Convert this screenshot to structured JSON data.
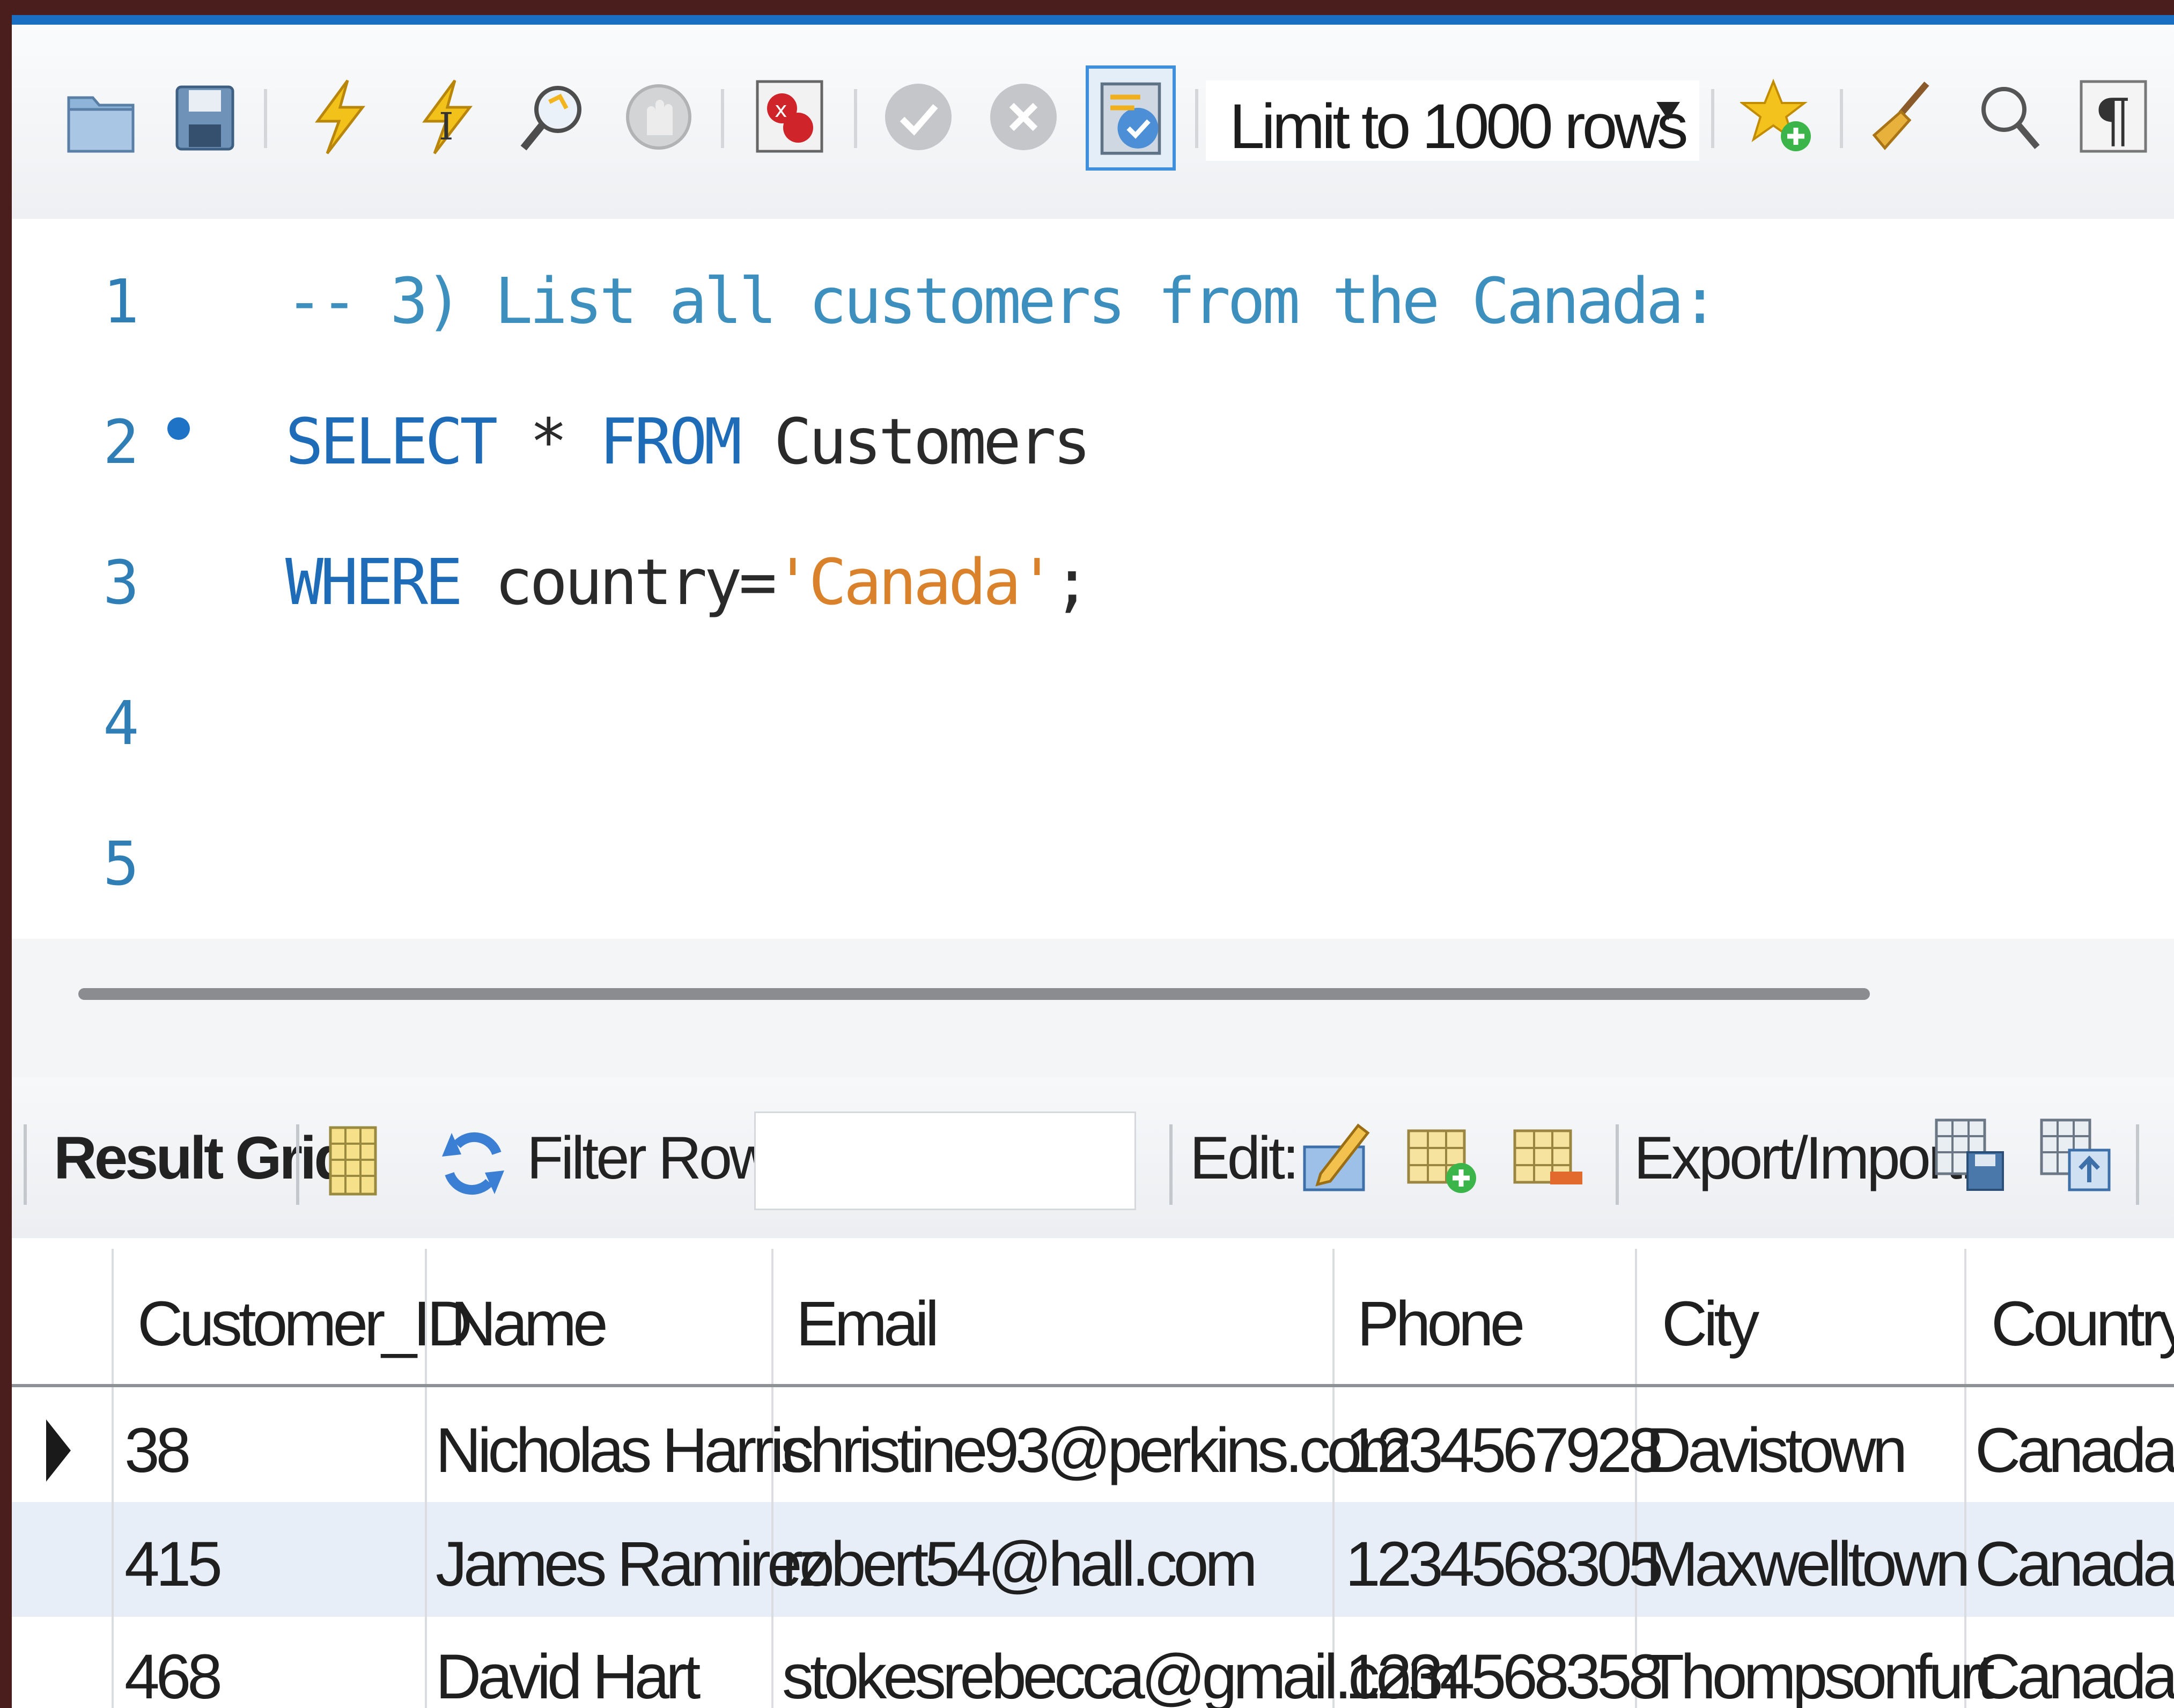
{
  "toolbar": {
    "icons": [
      "open-folder-icon",
      "save-icon",
      "execute-icon",
      "execute-current-icon",
      "explain-icon",
      "stop-icon",
      "toggle-error-icon",
      "commit-icon",
      "rollback-icon",
      "autocommit-icon",
      "bookmark-add-icon",
      "beautify-icon",
      "find-icon",
      "invisible-chars-icon"
    ],
    "limit_label": "Limit to 1000 rows"
  },
  "editor": {
    "line_numbers": [
      "1",
      "2",
      "3",
      "4",
      "5"
    ],
    "lines": [
      [
        {
          "text": "-- 3) List all customers from the Canada:",
          "cls": "cm"
        }
      ],
      [
        {
          "text": "SELECT",
          "cls": "kw"
        },
        {
          "text": " * ",
          "cls": "id"
        },
        {
          "text": "FROM",
          "cls": "kw"
        },
        {
          "text": " Customers",
          "cls": "id"
        }
      ],
      [
        {
          "text": "WHERE",
          "cls": "kw"
        },
        {
          "text": " country=",
          "cls": "id"
        },
        {
          "text": "'Canada'",
          "cls": "str"
        },
        {
          "text": ";",
          "cls": "id"
        }
      ],
      [],
      []
    ]
  },
  "result_toolbar": {
    "result_grid_label": "Result Grid",
    "filter_label": "Filter Rows:",
    "filter_value": "",
    "edit_label": "Edit:",
    "export_label": "Export/Import:"
  },
  "grid": {
    "columns": [
      "Customer_ID",
      "Name",
      "Email",
      "Phone",
      "City",
      "Country"
    ],
    "rows": [
      [
        "38",
        "Nicholas Harris",
        "christine93@perkins.com",
        "1234567928",
        "Davistown",
        "Canada"
      ],
      [
        "415",
        "James Ramirez",
        "robert54@hall.com",
        "1234568305",
        "Maxwelltown",
        "Canada"
      ],
      [
        "468",
        "David Hart",
        "stokesrebecca@gmail.com",
        "1234568358",
        "Thompsonfurt",
        "Canada"
      ]
    ]
  },
  "colors": {
    "accent": "#1b6fc3",
    "keyword": "#1e6cb8",
    "comment": "#3d8fbd",
    "string": "#d9822b",
    "selected_row": "#e7eef8"
  }
}
